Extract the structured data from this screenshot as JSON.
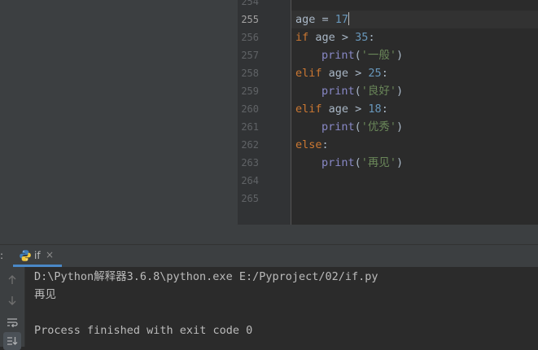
{
  "editor": {
    "line_numbers": [
      "254",
      "255",
      "256",
      "257",
      "258",
      "259",
      "260",
      "261",
      "262",
      "263",
      "264",
      "265"
    ],
    "current_line": "255",
    "code": {
      "l255": {
        "ident": "age",
        "op": " = ",
        "value": "17"
      },
      "l256": {
        "kw": "if",
        "rest": " age > ",
        "num": "35",
        "end": ":"
      },
      "l257": {
        "func": "print",
        "open": "(",
        "str": "'一般'",
        "close": ")"
      },
      "l258": {
        "kw": "elif",
        "rest": " age > ",
        "num": "25",
        "end": ":"
      },
      "l259": {
        "func": "print",
        "open": "(",
        "str": "'良好'",
        "close": ")"
      },
      "l260": {
        "kw": "elif",
        "rest": " age > ",
        "num": "18",
        "end": ":"
      },
      "l261": {
        "func": "print",
        "open": "(",
        "str": "'优秀'",
        "close": ")"
      },
      "l262": {
        "kw": "else",
        "end": ":"
      },
      "l263": {
        "func": "print",
        "open": "(",
        "str": "'再见'",
        "close": ")"
      }
    }
  },
  "run_panel": {
    "header_prefix": ":",
    "tab_label": "if",
    "tab_close": "×",
    "toolbar_icons": [
      "arrow-up-icon",
      "arrow-down-icon",
      "soft-wrap-icon",
      "scroll-to-end-icon"
    ],
    "console_lines": [
      "D:\\Python解释器3.6.8\\python.exe E:/Pyproject/02/if.py",
      "再见",
      "",
      "Process finished with exit code 0"
    ]
  },
  "colors": {
    "keyword": "#cc7832",
    "number": "#6897bb",
    "string": "#6a8759",
    "builtin": "#8888c6",
    "identifier": "#a9b7c6",
    "accent": "#4a88c7"
  }
}
